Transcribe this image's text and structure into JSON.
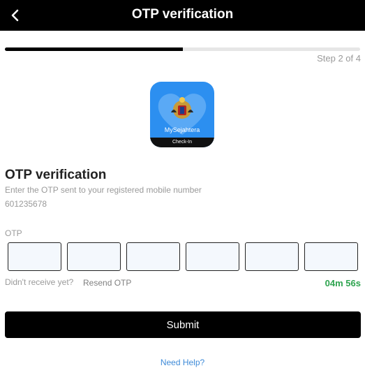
{
  "header": {
    "title": "OTP verification",
    "back_icon": "chevron-left-icon"
  },
  "progress": {
    "step_text": "Step 2 of 4",
    "fraction": 0.5
  },
  "logo": {
    "app_name": "MySejahtera",
    "band_text": "Check-In",
    "background_color": "#2c8ff0"
  },
  "main": {
    "title": "OTP verification",
    "subtitle": "Enter the OTP sent to your registered mobile number",
    "phone": "601235678"
  },
  "otp": {
    "label": "OTP",
    "digits": [
      "",
      "",
      "",
      "",
      "",
      ""
    ]
  },
  "resend": {
    "prompt": "Didn't receive yet?",
    "link_label": "Resend OTP",
    "timer": "04m 56s",
    "timer_color": "#2ea44f"
  },
  "actions": {
    "submit_label": "Submit",
    "help_label": "Need Help?"
  }
}
